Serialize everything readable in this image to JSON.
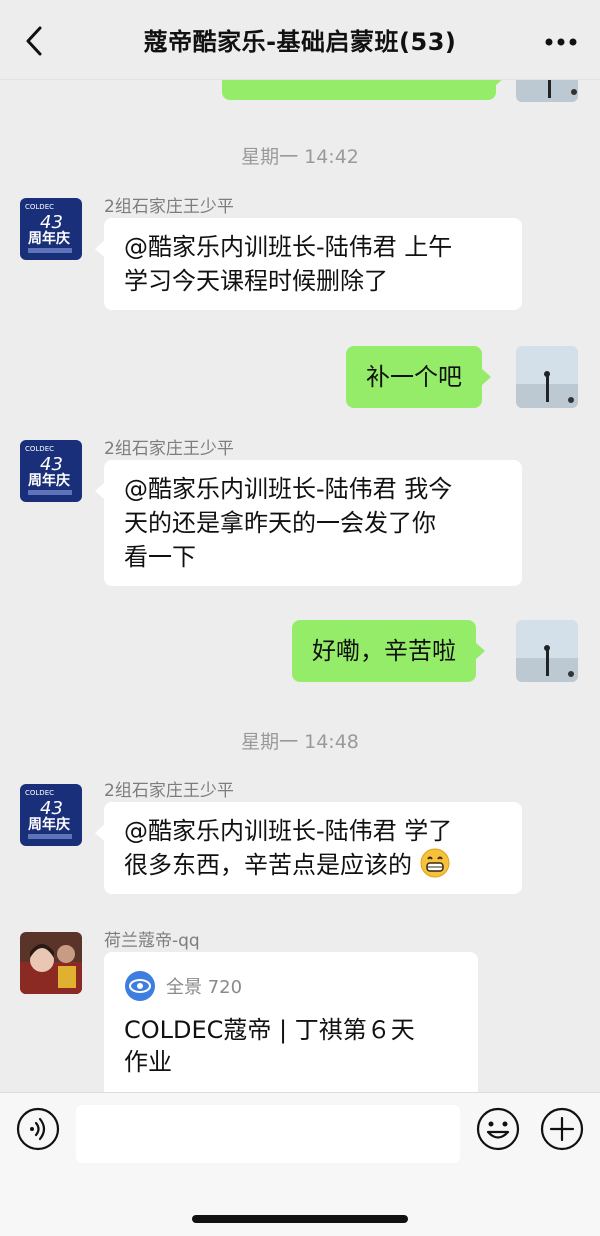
{
  "header": {
    "title": "蔻帝酷家乐-基础启蒙班(53)"
  },
  "messages": {
    "top_partial": "",
    "timestamp_1": "星期一 14:42",
    "sender_1": "2组石家庄王少平",
    "msg_1_line1": "@酷家乐内训班长-陆伟君 上午",
    "msg_1_line2": "学习今天课程时候删除了",
    "out_1": "补一个吧",
    "sender_2": "2组石家庄王少平",
    "msg_2_line1": "@酷家乐内训班长-陆伟君 我今",
    "msg_2_line2": "天的还是拿昨天的一会发了你",
    "msg_2_line3": "看一下",
    "out_2": "好嘞，辛苦啦",
    "timestamp_2": "星期一 14:48",
    "sender_3": "2组石家庄王少平",
    "msg_3_line1": "@酷家乐内训班长-陆伟君 学了",
    "msg_3_line2": "很多东西，辛苦点是应该的",
    "sender_4": "荷兰蔻帝-qq",
    "card_source": "全景 720",
    "card_title_line1": "COLDEC蔻帝 | 丁祺第６天",
    "card_title_line2": "作业"
  },
  "avatar_text": {
    "brand": "COLDEC",
    "number": "43",
    "label": "周年庆"
  },
  "input": {
    "placeholder": ""
  },
  "colors": {
    "outgoing_bubble": "#95ec69",
    "incoming_bubble": "#ffffff",
    "background": "#ededed"
  }
}
